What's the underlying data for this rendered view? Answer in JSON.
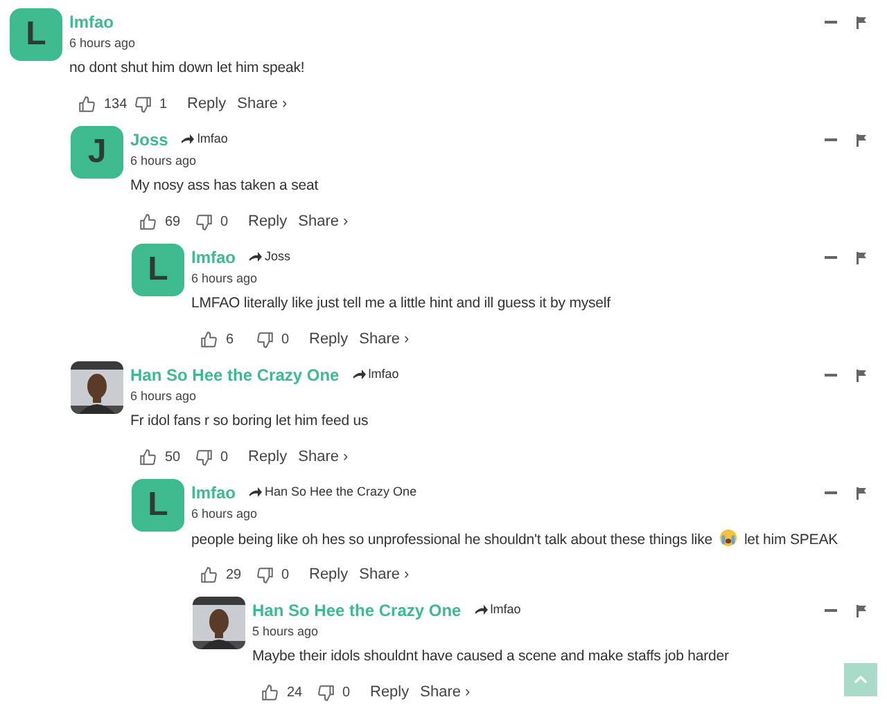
{
  "comments": [
    {
      "author": "lmfao",
      "avatar": {
        "kind": "letter",
        "letter": "L"
      },
      "time": "6 hours ago",
      "text": "no dont shut him down let him speak!",
      "likes": "134",
      "dislikes": "1",
      "reply": "Reply",
      "share": "Share ›",
      "children": [
        {
          "author": "Joss",
          "reply_to": "lmfao",
          "avatar": {
            "kind": "letter",
            "letter": "J"
          },
          "time": "6 hours ago",
          "text": "My nosy ass has taken a seat",
          "likes": "69",
          "dislikes": "0",
          "reply": "Reply",
          "share": "Share ›",
          "children": [
            {
              "author": "lmfao",
              "reply_to": "Joss",
              "avatar": {
                "kind": "letter",
                "letter": "L"
              },
              "time": "6 hours ago",
              "text": "LMFAO literally like just tell me a little hint and ill guess it by myself",
              "likes": "6",
              "dislikes": "0",
              "reply": "Reply",
              "share": "Share ›"
            }
          ]
        },
        {
          "author": "Han So Hee the Crazy One",
          "reply_to": "lmfao",
          "avatar": {
            "kind": "picture"
          },
          "time": "6 hours ago",
          "text": "Fr idol fans r so boring let him feed us",
          "likes": "50",
          "dislikes": "0",
          "reply": "Reply",
          "share": "Share ›",
          "children": [
            {
              "author": "lmfao",
              "reply_to": "Han So Hee the Crazy One",
              "avatar": {
                "kind": "letter",
                "letter": "L"
              },
              "time": "6 hours ago",
              "text": "people being like oh hes so unprofessional he shouldn't talk about these things like",
              "has_emoji": true,
              "text_after": "let him SPEAK",
              "likes": "29",
              "dislikes": "0",
              "reply": "Reply",
              "share": "Share ›",
              "children": [
                {
                  "author": "Han So Hee the Crazy One",
                  "reply_to": "lmfao",
                  "avatar": {
                    "kind": "picture"
                  },
                  "time": "5 hours ago",
                  "text": "Maybe their idols shouldnt have caused a scene and make staffs job harder",
                  "likes": "24",
                  "dislikes": "0",
                  "reply": "Reply",
                  "share": "Share ›"
                }
              ]
            }
          ]
        }
      ]
    }
  ]
}
